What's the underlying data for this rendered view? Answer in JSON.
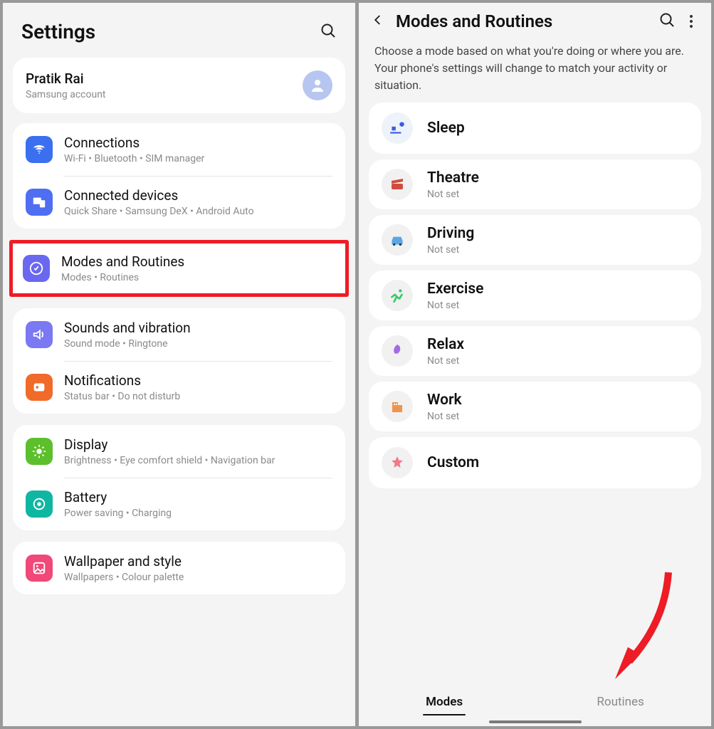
{
  "left": {
    "title": "Settings",
    "account": {
      "name": "Pratik Rai",
      "sub": "Samsung account"
    },
    "group1": [
      {
        "title": "Connections",
        "sub": "Wi-Fi  •  Bluetooth  •  SIM manager"
      },
      {
        "title": "Connected devices",
        "sub": "Quick Share  •  Samsung DeX  •  Android Auto"
      }
    ],
    "highlight": {
      "title": "Modes and Routines",
      "sub": "Modes  •  Routines"
    },
    "group2": [
      {
        "title": "Sounds and vibration",
        "sub": "Sound mode  •  Ringtone"
      },
      {
        "title": "Notifications",
        "sub": "Status bar  •  Do not disturb"
      }
    ],
    "group3": [
      {
        "title": "Display",
        "sub": "Brightness  •  Eye comfort shield  •  Navigation bar"
      },
      {
        "title": "Battery",
        "sub": "Power saving  •  Charging"
      }
    ],
    "group4": [
      {
        "title": "Wallpaper and style",
        "sub": "Wallpapers  •  Colour palette"
      }
    ]
  },
  "right": {
    "title": "Modes and Routines",
    "description": "Choose a mode based on what you're doing or where you are. Your phone's settings will change to match your activity or situation.",
    "modes": {
      "sleep": {
        "name": "Sleep"
      },
      "theatre": {
        "name": "Theatre",
        "sub": "Not set"
      },
      "driving": {
        "name": "Driving",
        "sub": "Not set"
      },
      "exercise": {
        "name": "Exercise",
        "sub": "Not set"
      },
      "relax": {
        "name": "Relax",
        "sub": "Not set"
      },
      "work": {
        "name": "Work",
        "sub": "Not set"
      },
      "custom": {
        "name": "Custom"
      }
    },
    "tabs": {
      "modes": "Modes",
      "routines": "Routines"
    }
  }
}
